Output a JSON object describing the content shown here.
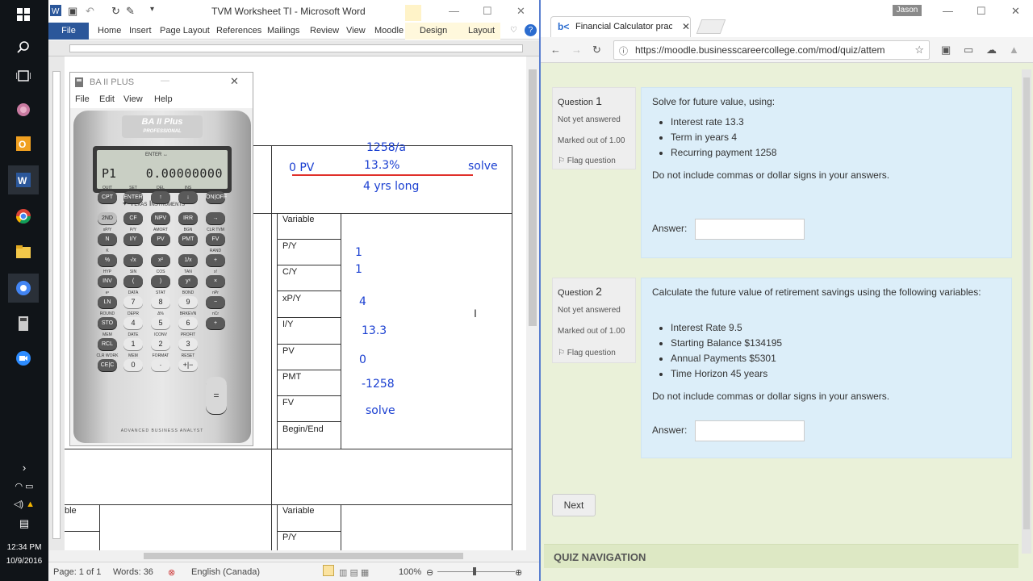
{
  "taskbar": {
    "clock_time": "12:34 PM",
    "clock_date": "10/9/2016"
  },
  "word": {
    "title": "TVM Worksheet TI  -  Microsoft Word",
    "tabs": [
      "Home",
      "Insert",
      "Page Layout",
      "References",
      "Mailings",
      "Review",
      "View",
      "Moodle",
      "Design",
      "Layout"
    ],
    "file_tab": "File",
    "status": {
      "page": "Page: 1 of 1",
      "words": "Words: 36",
      "language": "English (Canada)",
      "zoom": "100%"
    },
    "table": {
      "variables": [
        "Variable",
        "P/Y",
        "C/Y",
        "xP/Y",
        "I/Y",
        "PV",
        "PMT",
        "FV",
        "Begin/End"
      ],
      "left_fragments": [
        "b",
        "V"
      ],
      "bottom_left": "ble",
      "bottom_variables": [
        "Variable",
        "P/Y"
      ]
    },
    "handwriting": {
      "pv_note": "0 PV",
      "pmt_note": "1258/a",
      "rate_note": "13.3%",
      "solve_note": "solve",
      "term_note": "4 yrs long",
      "values": [
        "1",
        "1",
        "4",
        "13.3",
        "0",
        "-1258",
        "solve"
      ]
    }
  },
  "calculator": {
    "title": "BA II PLUS",
    "menu": [
      "File",
      "Edit",
      "View",
      "Help"
    ],
    "brand": "BA II Plus",
    "brand_sub": "PROFESSIONAL",
    "maker": "Texas Instruments",
    "lcd_annunciator": "ENTER  ↔",
    "lcd_var": "P1",
    "lcd_value": "0.00000000",
    "footer": "ADVANCED BUSINESS ANALYST",
    "keys": [
      {
        "label": "CPT",
        "second": "QUIT",
        "type": "dark"
      },
      {
        "label": "ENTER",
        "second": "SET",
        "type": "dark"
      },
      {
        "label": "↑",
        "second": "DEL",
        "type": "dark"
      },
      {
        "label": "↓",
        "second": "INS",
        "type": "dark"
      },
      {
        "label": "ON|OFF",
        "second": "",
        "type": "dark"
      },
      {
        "label": "2ND",
        "second": "",
        "type": "gray"
      },
      {
        "label": "CF",
        "second": "",
        "type": "dark"
      },
      {
        "label": "NPV",
        "second": "",
        "type": "dark"
      },
      {
        "label": "IRR",
        "second": "",
        "type": "dark"
      },
      {
        "label": "→",
        "second": "",
        "type": "dark"
      },
      {
        "label": "N",
        "second": "xP/Y",
        "type": "dark"
      },
      {
        "label": "I/Y",
        "second": "P/Y",
        "type": "dark"
      },
      {
        "label": "PV",
        "second": "AMORT",
        "type": "dark"
      },
      {
        "label": "PMT",
        "second": "BGN",
        "type": "dark"
      },
      {
        "label": "FV",
        "second": "CLR TVM",
        "type": "dark"
      },
      {
        "label": "%",
        "second": "K",
        "type": "dark"
      },
      {
        "label": "√x",
        "second": "",
        "type": "dark"
      },
      {
        "label": "x²",
        "second": "",
        "type": "dark"
      },
      {
        "label": "1/x",
        "second": "",
        "type": "dark"
      },
      {
        "label": "+",
        "second": "RAND",
        "type": "dark"
      },
      {
        "label": "INV",
        "second": "HYP",
        "type": "dark"
      },
      {
        "label": "(",
        "second": "SIN",
        "type": "dark"
      },
      {
        "label": ")",
        "second": "COS",
        "type": "dark"
      },
      {
        "label": "yˣ",
        "second": "TAN",
        "type": "dark"
      },
      {
        "label": "×",
        "second": "x!",
        "type": "dark"
      },
      {
        "label": "LN",
        "second": "eˣ",
        "type": "dark"
      },
      {
        "label": "7",
        "second": "DATA",
        "type": "num"
      },
      {
        "label": "8",
        "second": "STAT",
        "type": "num"
      },
      {
        "label": "9",
        "second": "BOND",
        "type": "num"
      },
      {
        "label": "−",
        "second": "nPr",
        "type": "dark"
      },
      {
        "label": "STO",
        "second": "ROUND",
        "type": "dark"
      },
      {
        "label": "4",
        "second": "DEPR",
        "type": "num"
      },
      {
        "label": "5",
        "second": "Δ%",
        "type": "num"
      },
      {
        "label": "6",
        "second": "BRKEVN",
        "type": "num"
      },
      {
        "label": "+",
        "second": "nCr",
        "type": "dark"
      },
      {
        "label": "RCL",
        "second": "MEM",
        "type": "dark"
      },
      {
        "label": "1",
        "second": "DATE",
        "type": "num"
      },
      {
        "label": "2",
        "second": "ICONV",
        "type": "num"
      },
      {
        "label": "3",
        "second": "PROFIT",
        "type": "num"
      },
      {
        "label": "CE|C",
        "second": "CLR WORK",
        "type": "dark"
      },
      {
        "label": "0",
        "second": "MEM",
        "type": "num"
      },
      {
        "label": "·",
        "second": "FORMAT",
        "type": "num"
      },
      {
        "label": "+|−",
        "second": "RESET",
        "type": "num"
      }
    ],
    "equals": "="
  },
  "browser": {
    "tab_title": "Financial Calculator prac",
    "user": "Jason",
    "url": "https://moodle.businesscareercollege.com/mod/quiz/attem"
  },
  "quiz": {
    "questions": [
      {
        "label": "Question",
        "number": "1",
        "status": "Not yet answered",
        "marks": "Marked out of 1.00",
        "flag": "Flag question",
        "prompt": "Solve for future value, using:",
        "items": [
          "Interest rate 13.3",
          "Term in years 4",
          "Recurring payment 1258"
        ],
        "note": "Do not include commas or dollar signs in your answers.",
        "answer_label": "Answer:",
        "answer_value": ""
      },
      {
        "label": "Question",
        "number": "2",
        "status": "Not yet answered",
        "marks": "Marked out of 1.00",
        "flag": "Flag question",
        "prompt": "Calculate the future value of retirement savings using the following variables:",
        "items": [
          "Interest Rate 9.5",
          "Starting Balance $134195",
          "Annual Payments $5301",
          "Time Horizon 45 years"
        ],
        "note": "Do not include commas or dollar signs in your answers.",
        "answer_label": "Answer:",
        "answer_value": ""
      }
    ],
    "next_button": "Next",
    "nav_heading": "QUIZ NAVIGATION"
  }
}
